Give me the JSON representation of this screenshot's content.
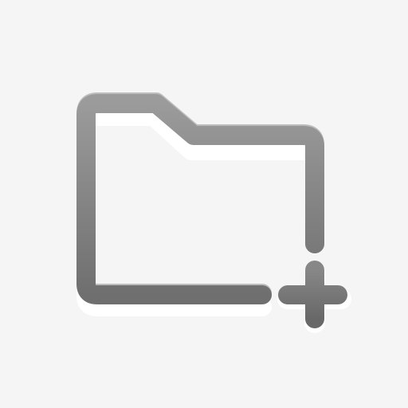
{
  "icon": {
    "name": "new-folder-icon",
    "background": "#f5f5f5",
    "folder_color_top": "#9b9b9b",
    "folder_color_bottom": "#6f6f6f",
    "plus_color_top": "#878787",
    "plus_color_bottom": "#686868",
    "highlight": "#ffffff",
    "edge_shadow": "#555555"
  }
}
